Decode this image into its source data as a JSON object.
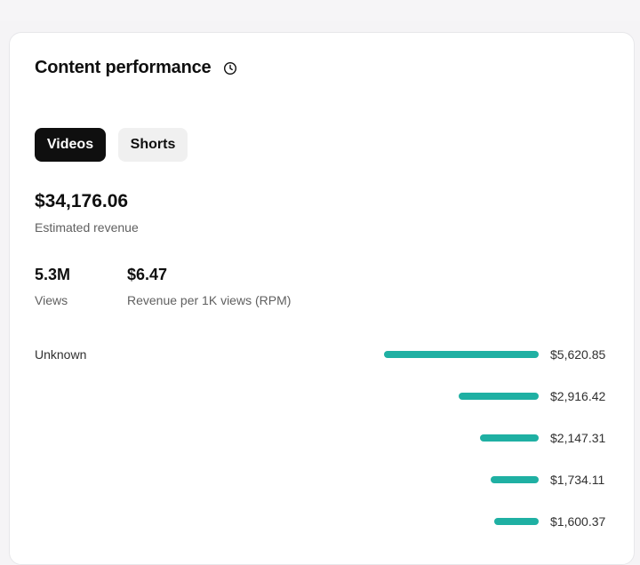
{
  "card": {
    "title": "Content performance",
    "tabs": [
      {
        "label": "Videos",
        "active": true
      },
      {
        "label": "Shorts",
        "active": false
      }
    ],
    "revenue": {
      "value": "$34,176.06",
      "label": "Estimated revenue"
    },
    "stats": [
      {
        "value": "5.3M",
        "label": "Views"
      },
      {
        "value": "$6.47",
        "label": "Revenue per 1K views (RPM)"
      }
    ],
    "breakdown": [
      {
        "label": "Unknown",
        "amount": "$5,620.85",
        "value": 5620.85
      },
      {
        "label": "",
        "amount": "$2,916.42",
        "value": 2916.42
      },
      {
        "label": "",
        "amount": "$2,147.31",
        "value": 2147.31
      },
      {
        "label": "",
        "amount": "$1,734.11",
        "value": 1734.11
      },
      {
        "label": "",
        "amount": "$1,600.37",
        "value": 1600.37
      }
    ]
  },
  "colors": {
    "accent": "#1fb0a3",
    "active_tab": "#0f0f0f",
    "inactive_tab": "#f0f0f0"
  },
  "icons": {
    "title_info": "clock-icon"
  }
}
